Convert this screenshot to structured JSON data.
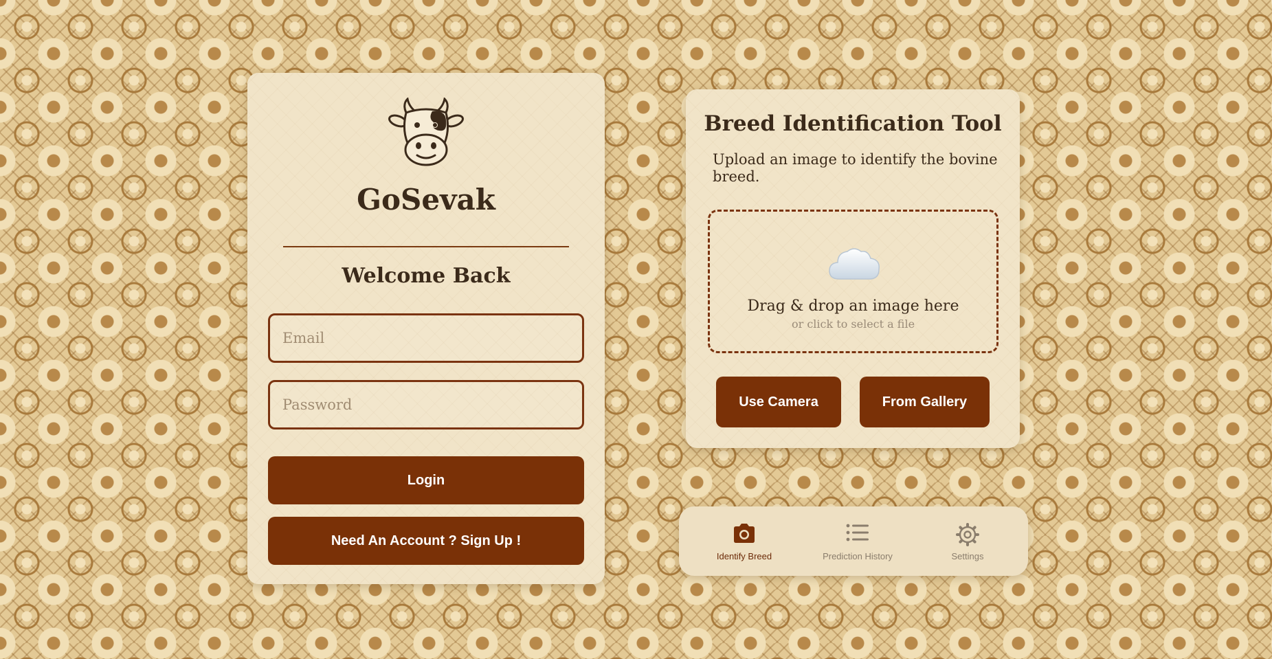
{
  "login": {
    "app_name": "GoSevak",
    "heading": "Welcome Back",
    "email_placeholder": "Email",
    "email_value": "",
    "password_placeholder": "Password",
    "password_value": "",
    "login_label": "Login",
    "signup_label": "Need An Account ? Sign Up !",
    "logo_icon": "cow-icon"
  },
  "breed_tool": {
    "title": "Breed Identification Tool",
    "subtitle": "Upload an image to identify the bovine breed.",
    "drop_main": "Drag & drop an image here",
    "drop_hint": "or click to select a file",
    "drop_icon": "cloud-icon",
    "camera_label": "Use Camera",
    "gallery_label": "From Gallery"
  },
  "nav": {
    "items": [
      {
        "label": "Identify Breed",
        "icon": "camera-icon",
        "active": true
      },
      {
        "label": "Prediction History",
        "icon": "list-icon",
        "active": false
      },
      {
        "label": "Settings",
        "icon": "gear-icon",
        "active": false
      }
    ]
  },
  "colors": {
    "primary": "#7a3107",
    "card": "#f1e4c8",
    "text": "#3b2a1a"
  }
}
